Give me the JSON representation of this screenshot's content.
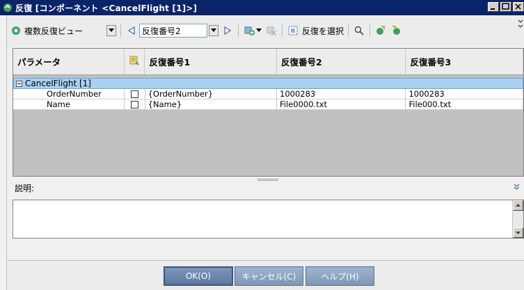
{
  "window": {
    "title": "反復 [コンポーネント <CancelFlight [1]>]"
  },
  "toolbar": {
    "view_label": "複数反復ビュー",
    "iteration_combo": "反復番号2",
    "select_iteration_label": "反復を選択"
  },
  "grid": {
    "headers": [
      "パラメータ",
      "反復番号1",
      "反復番号2",
      "反復番号3"
    ],
    "group_label": "CancelFlight [1]",
    "rows": [
      {
        "param": "OrderNumber",
        "it1": "{OrderNumber}",
        "it2": "1000283",
        "it3": "1000283"
      },
      {
        "param": "Name",
        "it1": "{Name}",
        "it2": "File0000.txt",
        "it3": "File000.txt"
      }
    ]
  },
  "description": {
    "label": "説明:"
  },
  "buttons": {
    "ok": "OK(O)",
    "cancel": "キャンセル(C)",
    "help": "ヘルプ(H)"
  }
}
